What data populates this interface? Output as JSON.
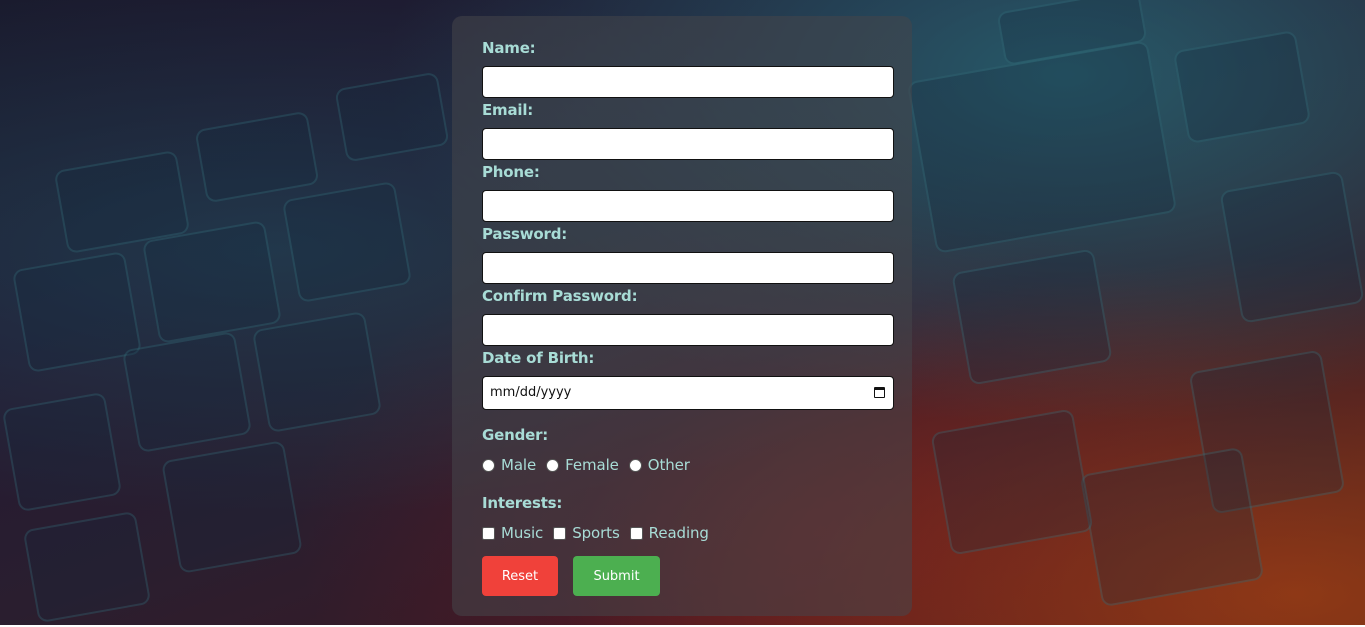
{
  "form": {
    "name_label": "Name:",
    "email_label": "Email:",
    "phone_label": "Phone:",
    "password_label": "Password:",
    "confirm_password_label": "Confirm Password:",
    "dob_label": "Date of Birth:",
    "dob_placeholder": "mm/dd/yyyy",
    "gender_label": "Gender:",
    "gender_options": [
      "Male",
      "Female",
      "Other"
    ],
    "interests_label": "Interests:",
    "interest_options": [
      "Music",
      "Sports",
      "Reading"
    ],
    "reset_label": "Reset",
    "submit_label": "Submit"
  },
  "colors": {
    "label": "#a8dcd6",
    "reset": "#f0413a",
    "submit": "#4caf50"
  },
  "icons": {
    "date_picker": "calendar-icon"
  }
}
